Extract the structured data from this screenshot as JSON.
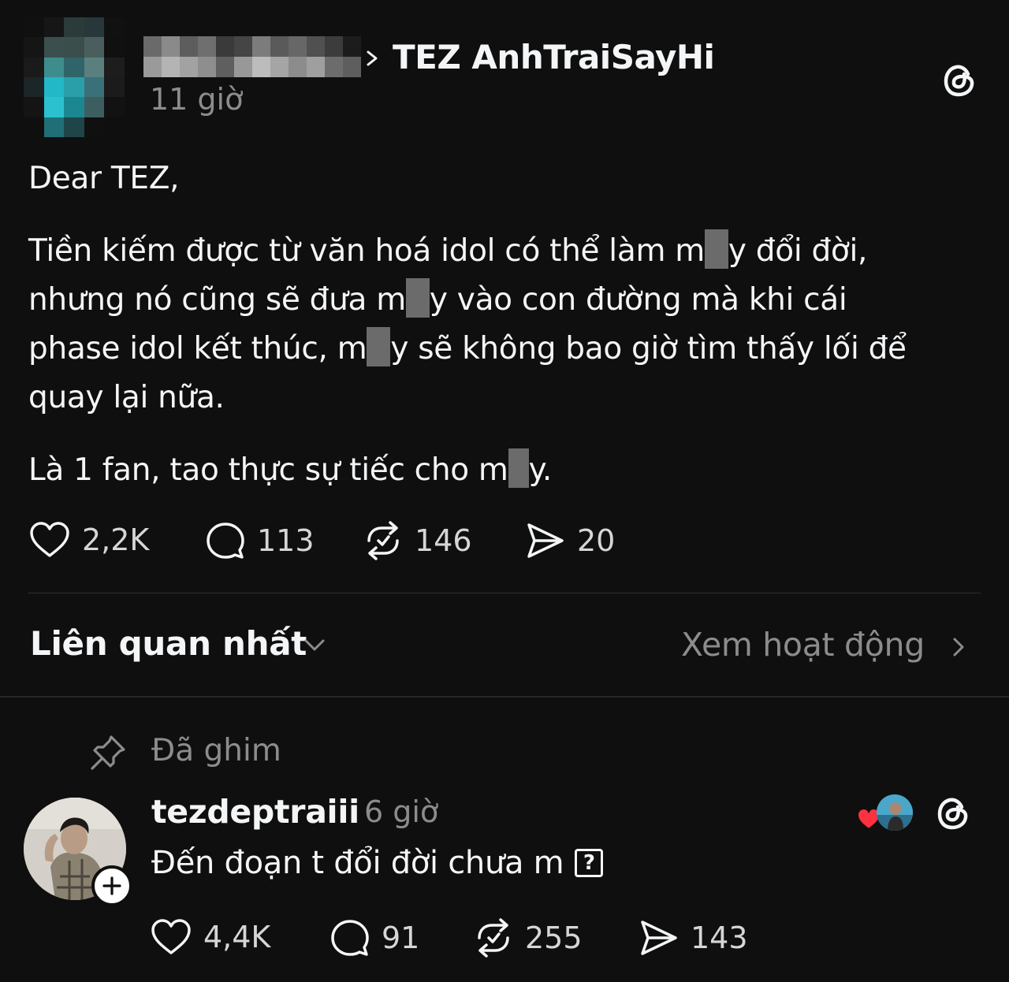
{
  "post": {
    "author": {
      "name_obscured": true,
      "avatar_obscured": true
    },
    "thread_title": "TEZ AnhTraiSayHi",
    "time": "11 giờ",
    "greeting": "Dear TEZ,",
    "paragraph_1": {
      "line_1": {
        "pre": "Tiền kiếm được từ văn hoá idol có thể làm m",
        "post": "y đổi đời,"
      },
      "line_2": {
        "pre": "nhưng nó cũng sẽ đưa m",
        "post": "y vào con đường mà khi cái"
      },
      "line_3": {
        "pre": "phase idol kết thúc, m",
        "post": "y sẽ không bao giờ tìm thấy lối để"
      },
      "line_4": "quay lại nữa."
    },
    "paragraph_2": {
      "pre": "Là 1 fan, tao thực sự tiếc cho m",
      "post": "y."
    },
    "stats": {
      "likes": "2,2K",
      "comments": "113",
      "reposts": "146",
      "shares": "20"
    }
  },
  "sort_bar": {
    "sort_label": "Liên quan nhất",
    "activity_label": "Xem hoạt động"
  },
  "reply": {
    "pinned_label": "Đã ghim",
    "username": "tezdeptraiii",
    "time": "6 giờ",
    "text": "Đến đoạn t đổi đời chưa m",
    "unknown_glyph": "?",
    "stats": {
      "likes": "4,4K",
      "comments": "91",
      "reposts": "255",
      "shares": "143"
    }
  },
  "colors": {
    "background": "#0f0f0f",
    "primary_text": "#f3f5f7",
    "secondary_text": "#8c8c8c",
    "liked_heart": "#ff3040"
  }
}
